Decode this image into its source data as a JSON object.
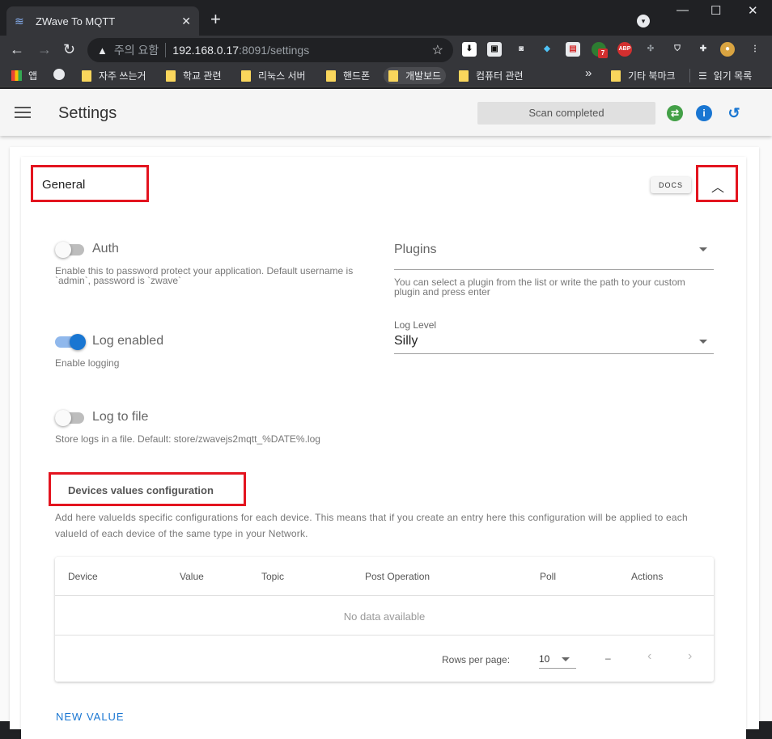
{
  "browser": {
    "tab_title": "ZWave To MQTT",
    "tab_close": "✕",
    "new_tab": "+",
    "address_warning": "주의 요함",
    "address_host": "192.168.0.17",
    "address_path": ":8091/settings",
    "bookmarks": [
      {
        "label": "앱"
      },
      {
        "label": ""
      },
      {
        "label": "자주 쓰는거"
      },
      {
        "label": "학교 관련"
      },
      {
        "label": "리눅스 서버"
      },
      {
        "label": "핸드폰"
      },
      {
        "label": "개발보드"
      },
      {
        "label": "컴퓨터 관련"
      }
    ],
    "bookmarks_overflow": "»",
    "other_bookmarks": "기타 북마크",
    "reading_list": "읽기 목록",
    "extension_badges": {
      "ublock": "7",
      "abp": "ABP"
    }
  },
  "app": {
    "title": "Settings",
    "scan_status": "Scan completed"
  },
  "general": {
    "title": "General",
    "docs_label": "DOCS",
    "auth": {
      "label": "Auth",
      "hint": "Enable this to password protect your application. Default username is `admin`, password is `zwave`",
      "enabled": false
    },
    "log_enabled": {
      "label": "Log enabled",
      "hint": "Enable logging",
      "enabled": true
    },
    "log_to_file": {
      "label": "Log to file",
      "hint": "Store logs in a file. Default: store/zwavejs2mqtt_%DATE%.log",
      "enabled": false
    },
    "plugins": {
      "placeholder": "Plugins",
      "hint": "You can select a plugin from the list or write the path to your custom plugin and press enter"
    },
    "log_level": {
      "caption": "Log Level",
      "value": "Silly"
    }
  },
  "devices_config": {
    "title": "Devices values configuration",
    "description": "Add here valueIds specific configurations for each device. This means that if you create an entry here this configuration will be applied to each valueId of each device of the same type in your Network.",
    "columns": [
      "Device",
      "Value",
      "Topic",
      "Post Operation",
      "Poll",
      "Actions"
    ],
    "empty_text": "No data available",
    "rows_per_page_label": "Rows per page:",
    "rows_per_page": "10",
    "page_range": "–",
    "new_value_label": "NEW VALUE"
  }
}
